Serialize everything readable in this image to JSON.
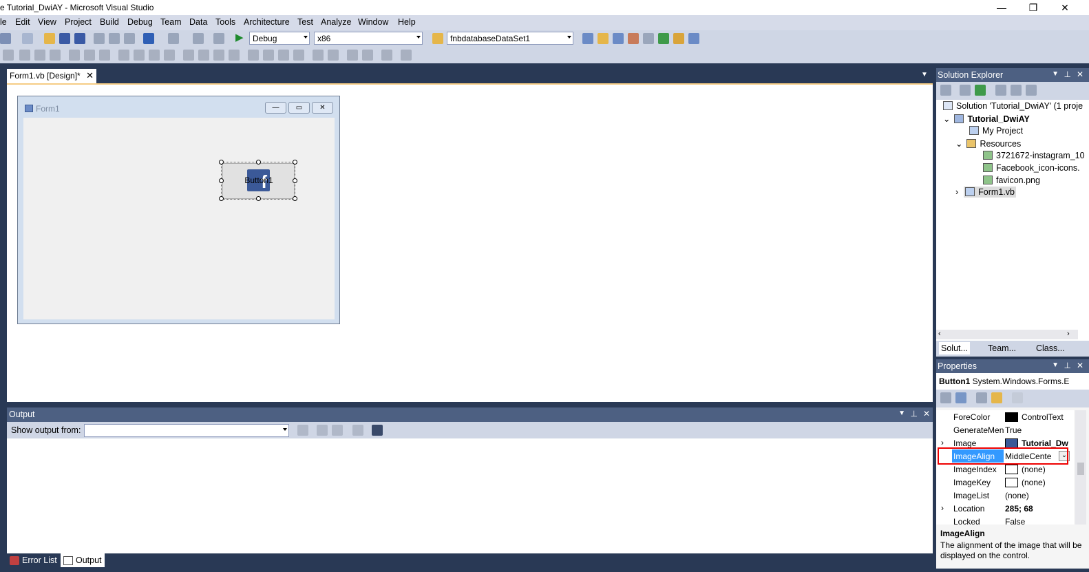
{
  "window": {
    "title": "e Tutorial_DwiAY - Microsoft Visual Studio",
    "min_icon": "minimize-icon",
    "restore_icon": "restore-icon",
    "close_icon": "close-icon"
  },
  "menu": [
    "le",
    "Edit",
    "View",
    "Project",
    "Build",
    "Debug",
    "Team",
    "Data",
    "Tools",
    "Architecture",
    "Test",
    "Analyze",
    "Window",
    "Help"
  ],
  "toolbar": {
    "config": "Debug",
    "platform": "x86",
    "dataset": "fnbdatabaseDataSet1"
  },
  "document_tab": {
    "label": "Form1.vb [Design]*",
    "close": "✕"
  },
  "designer": {
    "form_title": "Form1",
    "button_label": "Button1",
    "image_glyph": "f"
  },
  "output": {
    "title": "Output",
    "show_from_label": "Show output from:",
    "show_from_value": ""
  },
  "bottom_tabs": [
    "Error List",
    "Output"
  ],
  "solution_explorer": {
    "title": "Solution Explorer",
    "items": [
      "Solution 'Tutorial_DwiAY' (1 proje",
      "Tutorial_DwiAY",
      "My Project",
      "Resources",
      "3721672-instagram_10",
      "Facebook_icon-icons.",
      "favicon.png",
      "Form1.vb"
    ],
    "tabs": [
      "Solut...",
      "Team...",
      "Class..."
    ]
  },
  "properties": {
    "title": "Properties",
    "object_name": "Button1",
    "object_type": "System.Windows.Forms.E",
    "rows": [
      {
        "name": "ForeColor",
        "value": "ControlText"
      },
      {
        "name": "GenerateMen",
        "value": "True"
      },
      {
        "name": "Image",
        "value": "Tutorial_Dw"
      },
      {
        "name": "ImageAlign",
        "value": "MiddleCente"
      },
      {
        "name": "ImageIndex",
        "value": "(none)"
      },
      {
        "name": "ImageKey",
        "value": "(none)"
      },
      {
        "name": "ImageList",
        "value": "(none)"
      },
      {
        "name": "Location",
        "value": "285; 68"
      },
      {
        "name": "Locked",
        "value": "False"
      }
    ],
    "desc_title": "ImageAlign",
    "desc_text": "The alignment of the image that will be displayed on the control."
  },
  "colors": {
    "accent": "#293955",
    "header": "#4d6082",
    "highlight": "#e00000",
    "selected": "#3399ff"
  }
}
